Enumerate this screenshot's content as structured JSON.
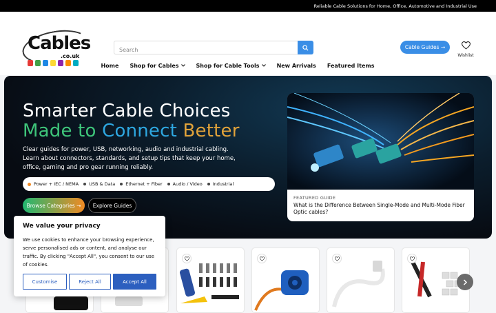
{
  "topbar": {
    "text": "Reliable Cable Solutions for Home, Office, Automotive and Industrial Use"
  },
  "logo": {
    "text": "Cables",
    "sub": ".co.uk"
  },
  "search": {
    "placeholder": "Search",
    "icon": "search-icon"
  },
  "header": {
    "cable_guides_label": "Cable Guides →",
    "wishlist_label": "Wishlist"
  },
  "nav": {
    "items": [
      {
        "label": "Home"
      },
      {
        "label": "Shop for Cables"
      },
      {
        "label": "Shop for Cable Tools"
      },
      {
        "label": "New Arrivals"
      },
      {
        "label": "Featured Items"
      }
    ]
  },
  "hero": {
    "title_line1": "Smarter Cable Choices",
    "title_made": "Made to ",
    "title_connect": "Connect ",
    "title_better": "Better",
    "description": "Clear guides for power, USB, networking, audio and industrial cabling. Learn about connectors, standards, and setup tips that keep your home, office, gaming and pro gear running reliably.",
    "pills": [
      "Power + IEC / NEMA",
      "USB & Data",
      "Ethernet + Fiber",
      "Audio / Video",
      "Industrial"
    ],
    "browse_label": "Browse Categories →",
    "explore_label": "Explore Guides",
    "featured": {
      "kicker": "FEATURED GUIDE",
      "title": "What is the Difference Between Single-Mode and Multi-Mode Fiber Optic cables?"
    }
  },
  "cookie": {
    "title": "We value your privacy",
    "text": "We use cookies to enhance your browsing experience, serve personalised ads or content, and analyse our traffic. By clicking \"Accept All\", you consent to our use of cookies.",
    "customise": "Customise",
    "reject": "Reject All",
    "accept": "Accept All"
  },
  "colors": {
    "accent": "#3a8ee6",
    "cookie_blue": "#2c5fbf",
    "green": "#3ec57a",
    "orange": "#f08a24"
  }
}
